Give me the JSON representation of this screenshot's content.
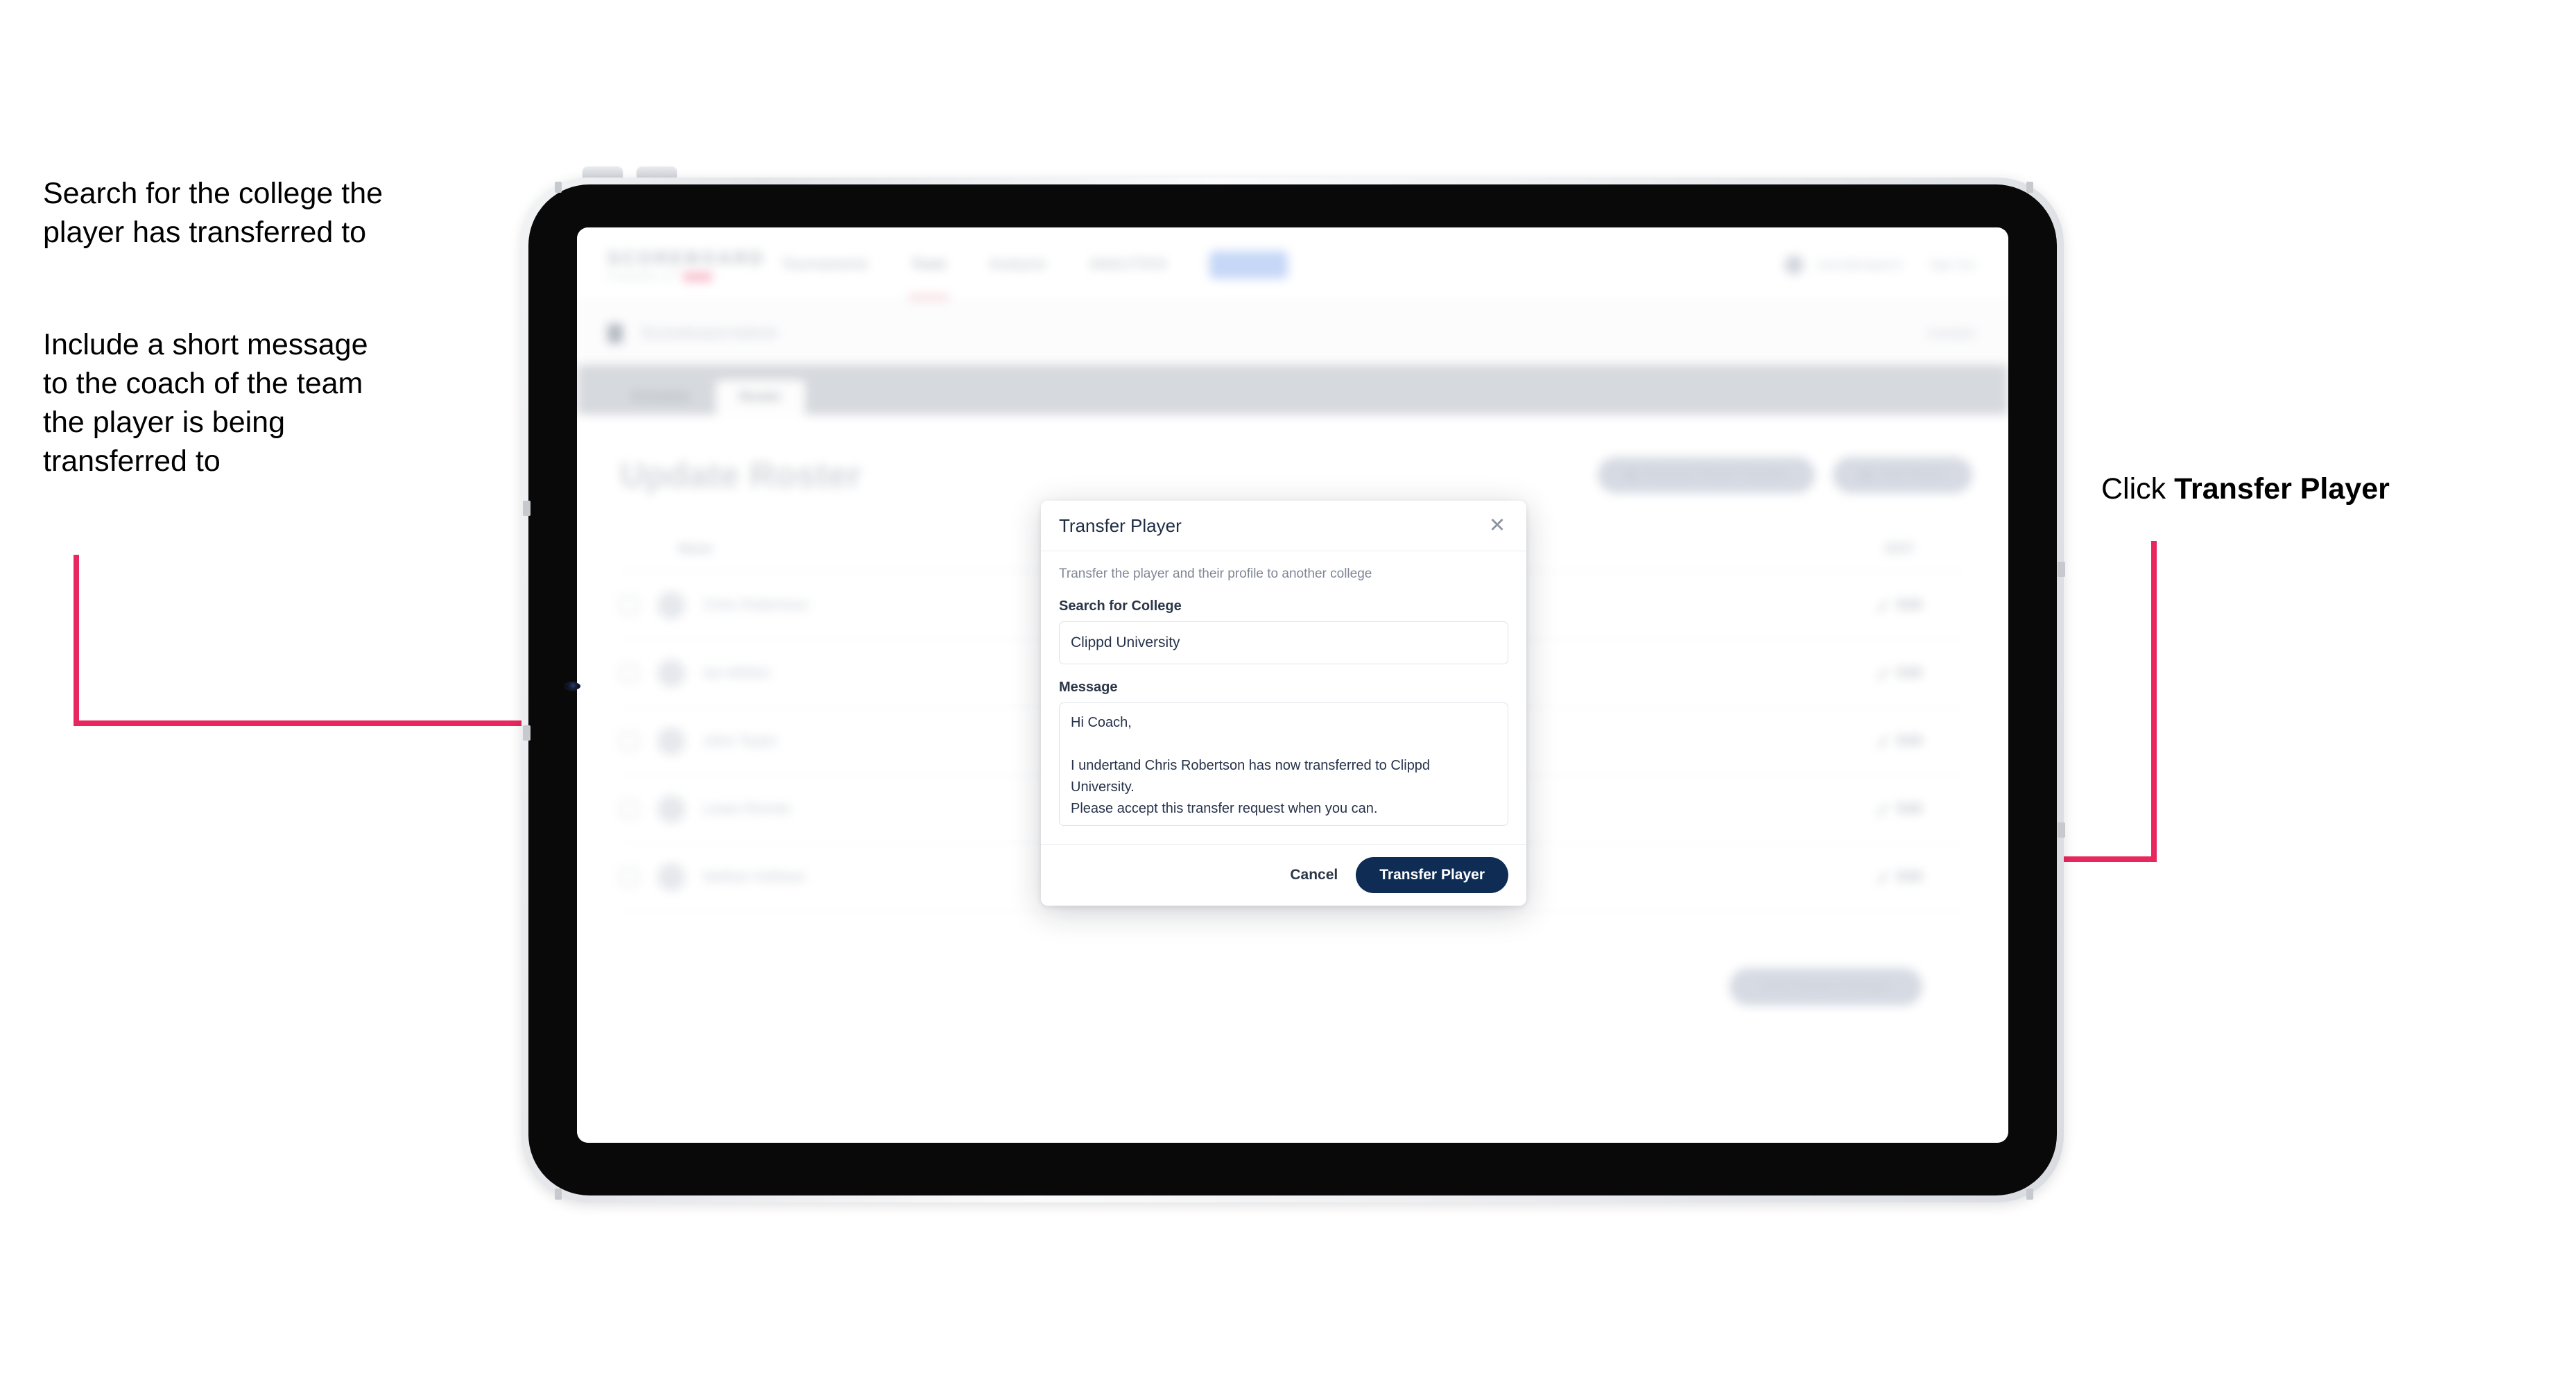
{
  "annotations": {
    "left_1": "Search for the college the\nplayer has transferred to",
    "left_2": "Include a short message\nto the coach of the team\nthe player is being\ntransferred to",
    "right_1_prefix": "Click ",
    "right_1_bold": "Transfer Player"
  },
  "colors": {
    "accent_pink": "#e8275f",
    "primary_navy": "#0e2c54",
    "device_bezel": "#090909"
  },
  "app": {
    "nav": {
      "logo_main": "SCOREBOARD",
      "logo_sub": "POWERED BY",
      "logo_badge": "clippd",
      "links": [
        {
          "label": "Tournaments",
          "active": false
        },
        {
          "label": "Team",
          "active": true
        },
        {
          "label": "Analysis",
          "active": false
        },
        {
          "label": "ANALYTICS",
          "active": false
        }
      ],
      "pill_label": "Roster",
      "user_email": "coach@clippd.io",
      "sign_out": "Sign Out"
    },
    "breadcrumb": {
      "title": "Scoreboard",
      "suffix": " Admin",
      "right_action": "Contact"
    },
    "tabs": [
      {
        "label": "Schedule",
        "active": false
      },
      {
        "label": "Roster",
        "active": true
      }
    ],
    "page": {
      "title": "Update Roster",
      "actions": [
        {
          "label": "Request Player Transfer",
          "icon": "transfer-icon"
        },
        {
          "label": "Add Player",
          "icon": "plus-icon"
        }
      ],
      "table": {
        "columns": {
          "name": "Name",
          "edit": "EDIT"
        },
        "rows": [
          {
            "name": "Chris Robertson",
            "edit": "Edit"
          },
          {
            "name": "Ian Mildon",
            "edit": "Edit"
          },
          {
            "name": "John Taylor",
            "edit": "Edit"
          },
          {
            "name": "Lewis Rennie",
            "edit": "Edit"
          },
          {
            "name": "Nathan Hollows",
            "edit": "Edit"
          }
        ]
      },
      "save_label": "Save Roster Changes"
    }
  },
  "modal": {
    "title": "Transfer Player",
    "close_icon": "✕",
    "subtitle": "Transfer the player and their profile to another college",
    "college_label": "Search for College",
    "college_value": "Clippd University",
    "college_placeholder": "Search for College",
    "message_label": "Message",
    "message_value": "Hi Coach,\n\nI undertand Chris Robertson has now transferred to Clippd University.\nPlease accept this transfer request when you can.",
    "message_placeholder": "Message",
    "cancel_label": "Cancel",
    "submit_label": "Transfer Player"
  }
}
